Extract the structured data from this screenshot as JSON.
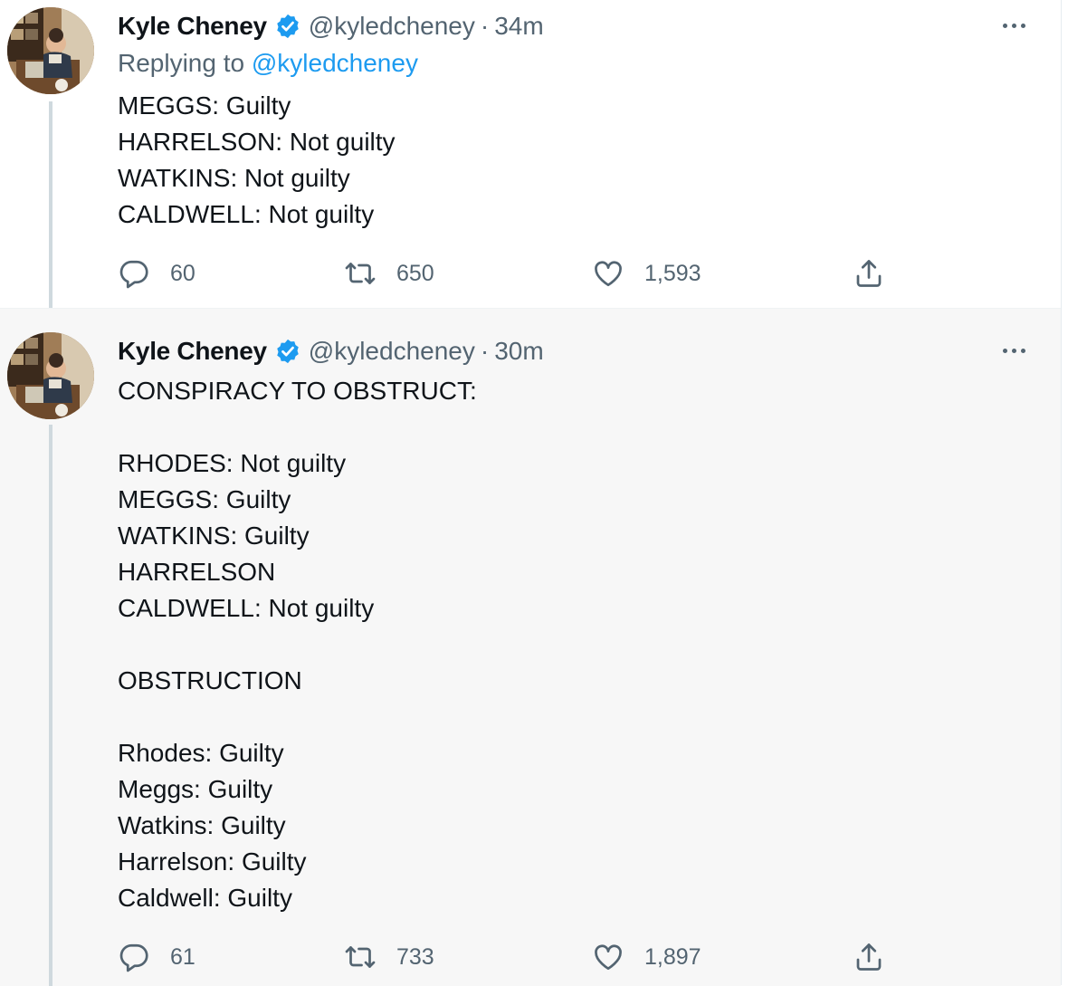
{
  "colors": {
    "text": "#0f1419",
    "secondary": "#536471",
    "link": "#1d9bf0",
    "verified": "#1d9bf0",
    "highlight_bg": "#f7f7f7"
  },
  "tweets": [
    {
      "author": {
        "name": "Kyle Cheney",
        "handle": "@kyledcheney",
        "verified": true
      },
      "separator": "·",
      "time": "34m",
      "reply_prefix": "Replying to ",
      "reply_to": "@kyledcheney",
      "text": "MEGGS: Guilty\nHARRELSON: Not guilty\nWATKINS: Not guilty\nCALDWELL: Not guilty",
      "counts": {
        "replies": "60",
        "retweets": "650",
        "likes": "1,593"
      },
      "icons": {
        "reply": "reply-icon",
        "retweet": "retweet-icon",
        "like": "heart-icon",
        "share": "share-icon",
        "more": "more-icon"
      }
    },
    {
      "author": {
        "name": "Kyle Cheney",
        "handle": "@kyledcheney",
        "verified": true
      },
      "separator": "·",
      "time": "30m",
      "text": "CONSPIRACY TO OBSTRUCT:\n\nRHODES: Not guilty\nMEGGS: Guilty\nWATKINS: Guilty\nHARRELSON\nCALDWELL: Not guilty\n\nOBSTRUCTION\n\nRhodes: Guilty\nMeggs: Guilty\nWatkins: Guilty\nHarrelson: Guilty\nCaldwell: Guilty",
      "counts": {
        "replies": "61",
        "retweets": "733",
        "likes": "1,897"
      },
      "icons": {
        "reply": "reply-icon",
        "retweet": "retweet-icon",
        "like": "heart-icon",
        "share": "share-icon",
        "more": "more-icon"
      }
    }
  ]
}
